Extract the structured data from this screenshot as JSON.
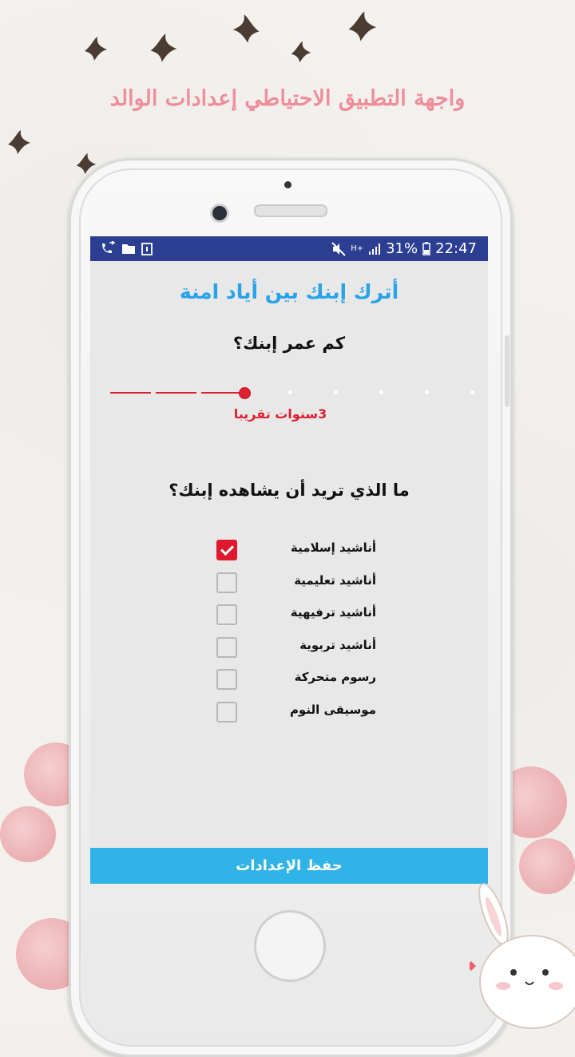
{
  "promo": {
    "headline": "واجهة التطبيق الاحتياطي إعدادات الوالد"
  },
  "statusbar": {
    "left_icons": [
      "call-forward-icon",
      "folder-icon",
      "clipboard-icon"
    ],
    "right_icons": [
      "mute-icon",
      "signal-icon"
    ],
    "network": "H+",
    "battery": "31%",
    "time": "22:47"
  },
  "app": {
    "title": "أترك إبنك بين أياد امنة",
    "age_question": "كم عمر إبنك؟",
    "age_slider": {
      "value": 3,
      "steps": 9
    },
    "age_value_text": "3سنوات تقريبا",
    "content_question": "ما الذي تريد أن يشاهده إبنك؟",
    "options": [
      {
        "label": "أناشيد إسلامية",
        "checked": true
      },
      {
        "label": "أناشيد تعليمية",
        "checked": false
      },
      {
        "label": "أناشيد ترفيهية",
        "checked": false
      },
      {
        "label": "أناشيد تربوية",
        "checked": false
      },
      {
        "label": "رسوم متحركة",
        "checked": false
      },
      {
        "label": "موسيقى النوم",
        "checked": false
      }
    ],
    "save_label": "حفظ الإعدادات"
  },
  "colors": {
    "accent_blue": "#27a3e8",
    "slider_red": "#e02030",
    "save_button": "#30b3e6",
    "statusbar": "#2c3e91",
    "headline_pink": "#ef8d9b"
  }
}
